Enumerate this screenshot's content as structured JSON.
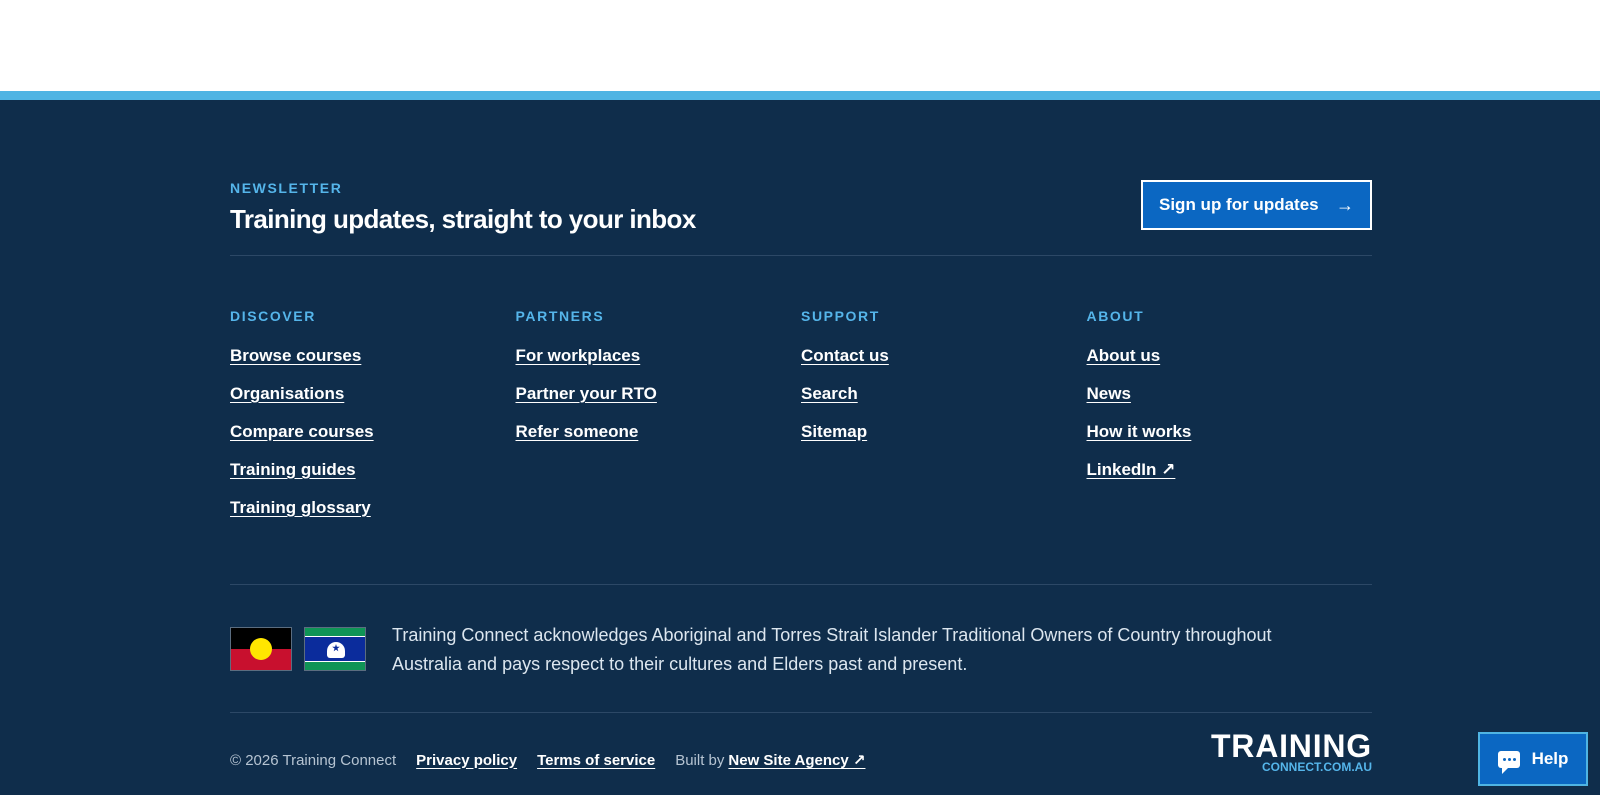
{
  "newsletter": {
    "eyebrow": "NEWSLETTER",
    "title": "Training updates, straight to your inbox",
    "button_label": "Sign up for updates",
    "button_icon": "arrow-right-icon"
  },
  "columns": [
    {
      "heading": "DISCOVER",
      "links": [
        "Browse courses",
        "Organisations",
        "Compare courses",
        "Training guides",
        "Training glossary"
      ]
    },
    {
      "heading": "PARTNERS",
      "links": [
        "For workplaces",
        "Partner your RTO",
        "Refer someone"
      ]
    },
    {
      "heading": "SUPPORT",
      "links": [
        "Contact us",
        "Search",
        "Sitemap"
      ]
    },
    {
      "heading": "ABOUT",
      "links": [
        "About us",
        "News",
        "How it works",
        "LinkedIn ↗"
      ]
    }
  ],
  "acknowledgement": {
    "text": "Training Connect acknowledges Aboriginal and Torres Strait Islander Traditional Owners of Country throughout Australia and pays respect to their cultures and Elders past and present.",
    "flags": [
      "aboriginal-flag-icon",
      "torres-strait-islander-flag-icon"
    ]
  },
  "bottom": {
    "copyright": "© 2026 Training Connect",
    "privacy": "Privacy policy",
    "terms": "Terms of service",
    "built_by": "Built by",
    "agency": "New Site Agency ↗"
  },
  "logo": {
    "main": "TRAINING",
    "sub": "CONNECT.COM.AU"
  },
  "help": {
    "label": "Help",
    "icon": "chat-bubble-icon"
  },
  "colors": {
    "footer_bg": "#0f2d4b",
    "accent_bar": "#4fb4e3",
    "eyebrow": "#55b5ea",
    "button": "#0b67c2"
  }
}
